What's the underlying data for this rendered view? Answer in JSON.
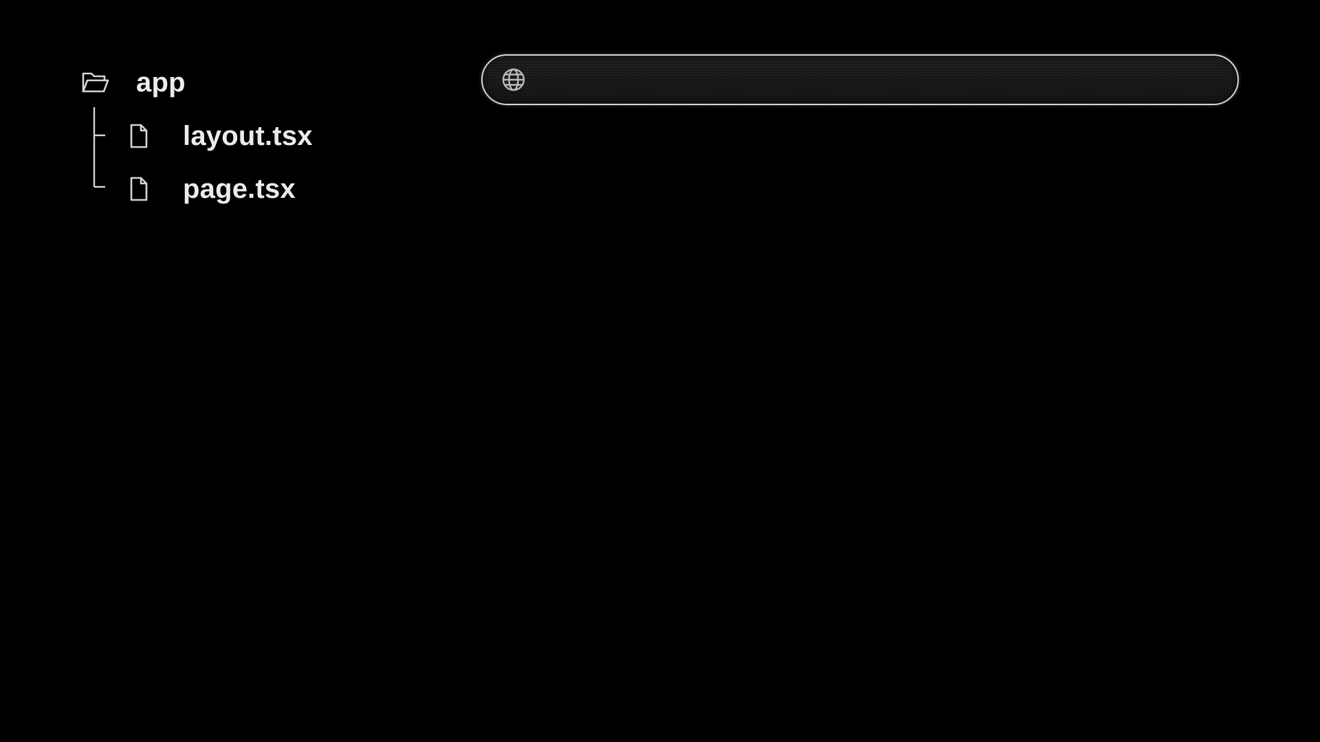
{
  "file_tree": {
    "root": {
      "label": "app",
      "icon": "folder-open-icon"
    },
    "children": [
      {
        "label": "layout.tsx",
        "icon": "file-icon"
      },
      {
        "label": "page.tsx",
        "icon": "file-icon"
      }
    ]
  },
  "address_bar": {
    "icon": "globe-icon",
    "value": "",
    "placeholder": ""
  },
  "colors": {
    "background": "#000000",
    "text": "#ececec",
    "icon_stroke": "#d6d6d6",
    "bar_border": "#d8d8d8",
    "bar_fill": "#161618"
  }
}
